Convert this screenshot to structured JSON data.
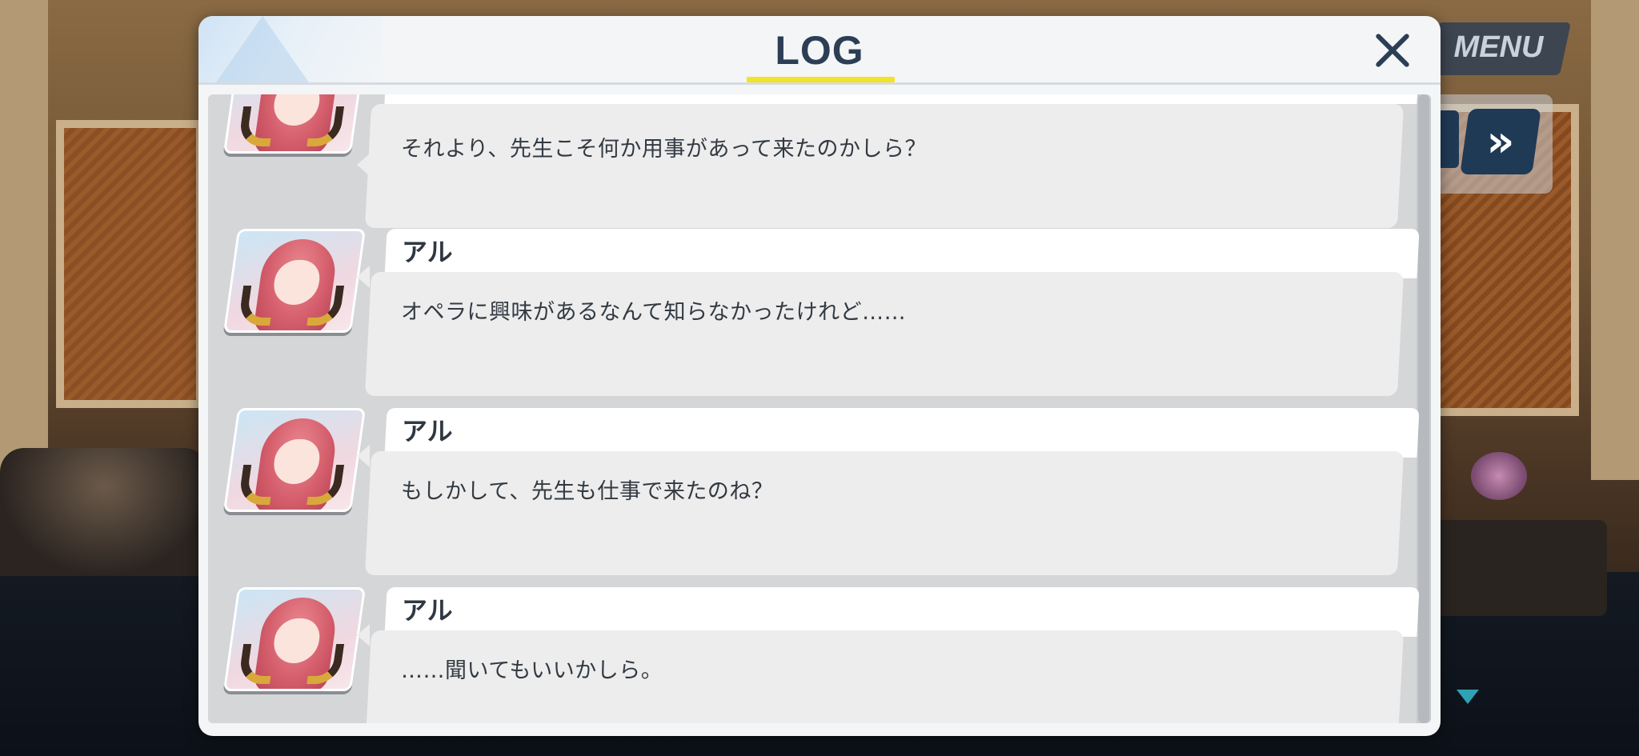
{
  "screen": {
    "menu_label": "MENU",
    "skip_icon": "fast-forward-icon"
  },
  "log": {
    "title": "LOG",
    "close_icon": "close-icon",
    "entries": [
      {
        "speaker": "",
        "text": "それより、先生こそ何か用事があって来たのかしら？"
      },
      {
        "speaker": "アル",
        "text": "オペラに興味があるなんて知らなかったけれど……"
      },
      {
        "speaker": "アル",
        "text": "もしかして、先生も仕事で来たのね？"
      },
      {
        "speaker": "アル",
        "text": "……聞いてもいいかしら。"
      }
    ]
  }
}
